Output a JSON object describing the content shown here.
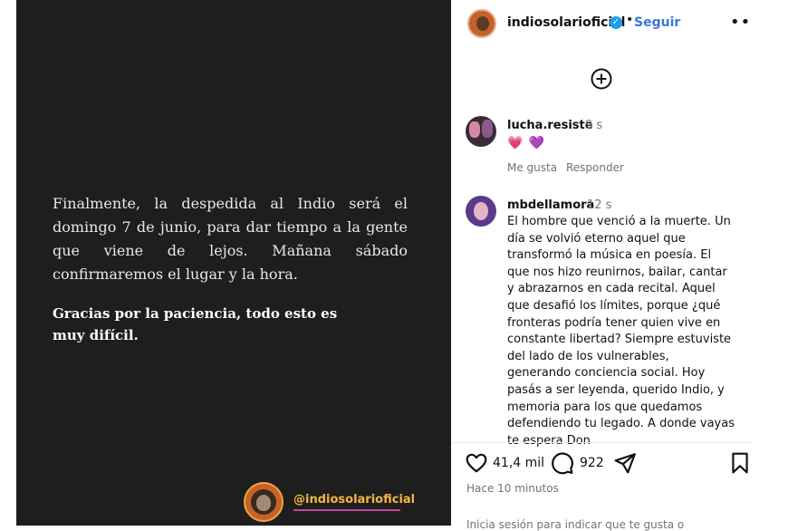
{
  "media": {
    "paragraph": "Finalmente, la despedida al Indio será el domingo 7 de junio, para dar tiempo a la gente que viene de lejos.  Mañana sábado confirmaremos el lugar y la hora.",
    "emphasis": "Gracias por la paciencia, todo esto es muy difícil.",
    "handle": "@indiosolarioficial"
  },
  "header": {
    "username": "indiosolarioficial",
    "verified_icon": "✓",
    "separator": "•",
    "follow_label": "Seguir",
    "more_icon": "•••"
  },
  "comments": [
    {
      "username": "lucha.resiste",
      "time": "9 s",
      "emoji": [
        "💗",
        "💜"
      ],
      "like_label": "Me gusta",
      "reply_label": "Responder"
    },
    {
      "username": "mbdellamora",
      "time": "12 s",
      "text": "El hombre que venció a la muerte. Un día se volvió eterno aquel que transformó la música en poesía. El que nos hizo reunirnos, bailar, cantar y abrazarnos en cada recital. Aquel que desafió los límites, porque ¿qué fronteras podría tener quien vive en constante libertad? Siempre estuviste del lado de los vulnerables, generando conciencia social. Hoy pasás a ser leyenda, querido Indio, y memoria para los que quedamos defendiendo tu legado. A donde vayas te espera Don"
    }
  ],
  "actions": {
    "likes": "41,4 mil",
    "comments": "922",
    "time_ago": "Hace 10 minutos",
    "login_hint": "Inicia sesión para indicar que te gusta o"
  },
  "colors": {
    "media_bg": "#1e1e1e",
    "handle": "#f4b642",
    "follow": "#3a78d8",
    "verified": "#1d9bf0"
  }
}
